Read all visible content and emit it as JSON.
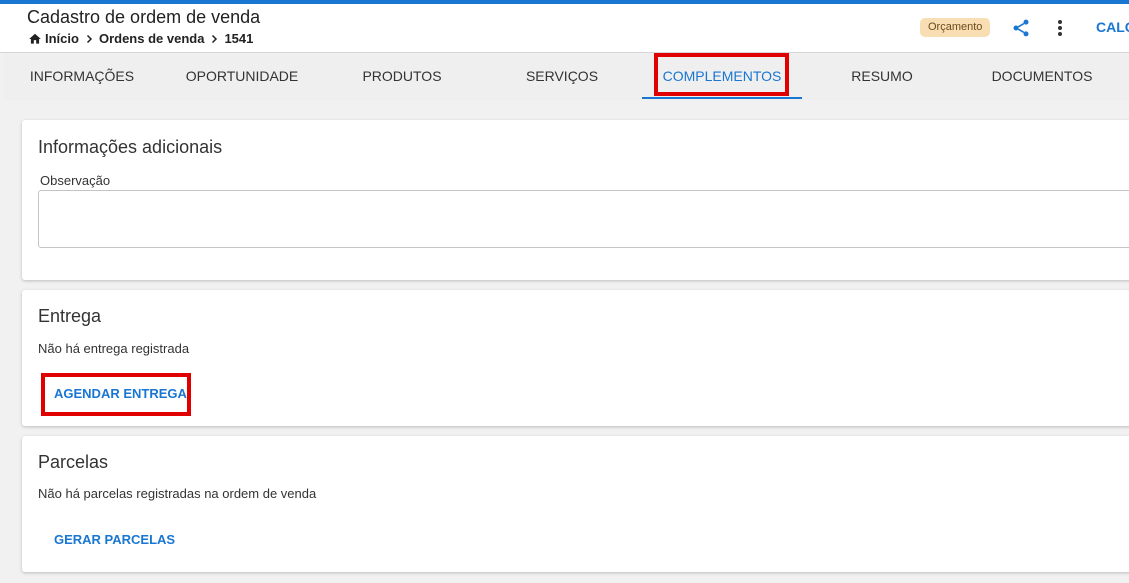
{
  "header": {
    "title": "Cadastro de ordem de venda",
    "breadcrumb": [
      "Início",
      "Ordens de venda",
      "1541"
    ],
    "status": "Orçamento",
    "action_label": "CALC",
    "icons": [
      "home-icon",
      "chevron-right-icon",
      "share-icon",
      "more-vert-icon"
    ]
  },
  "tabs": [
    {
      "label": "INFORMAÇÕES"
    },
    {
      "label": "OPORTUNIDADE"
    },
    {
      "label": "PRODUTOS"
    },
    {
      "label": "SERVIÇOS"
    },
    {
      "label": "COMPLEMENTOS",
      "active": true
    },
    {
      "label": "RESUMO"
    },
    {
      "label": "DOCUMENTOS"
    }
  ],
  "sections": {
    "info": {
      "title": "Informações adicionais",
      "observation_label": "Observação",
      "observation_value": ""
    },
    "delivery": {
      "title": "Entrega",
      "empty_text": "Não há entrega registrada",
      "button": "AGENDAR ENTREGA"
    },
    "installments": {
      "title": "Parcelas",
      "empty_text": "Não há parcelas registradas na ordem de venda",
      "button": "GERAR PARCELAS"
    }
  },
  "colors": {
    "accent": "#1976d2",
    "highlight": "#e00000",
    "badge": "#f9deb3"
  }
}
